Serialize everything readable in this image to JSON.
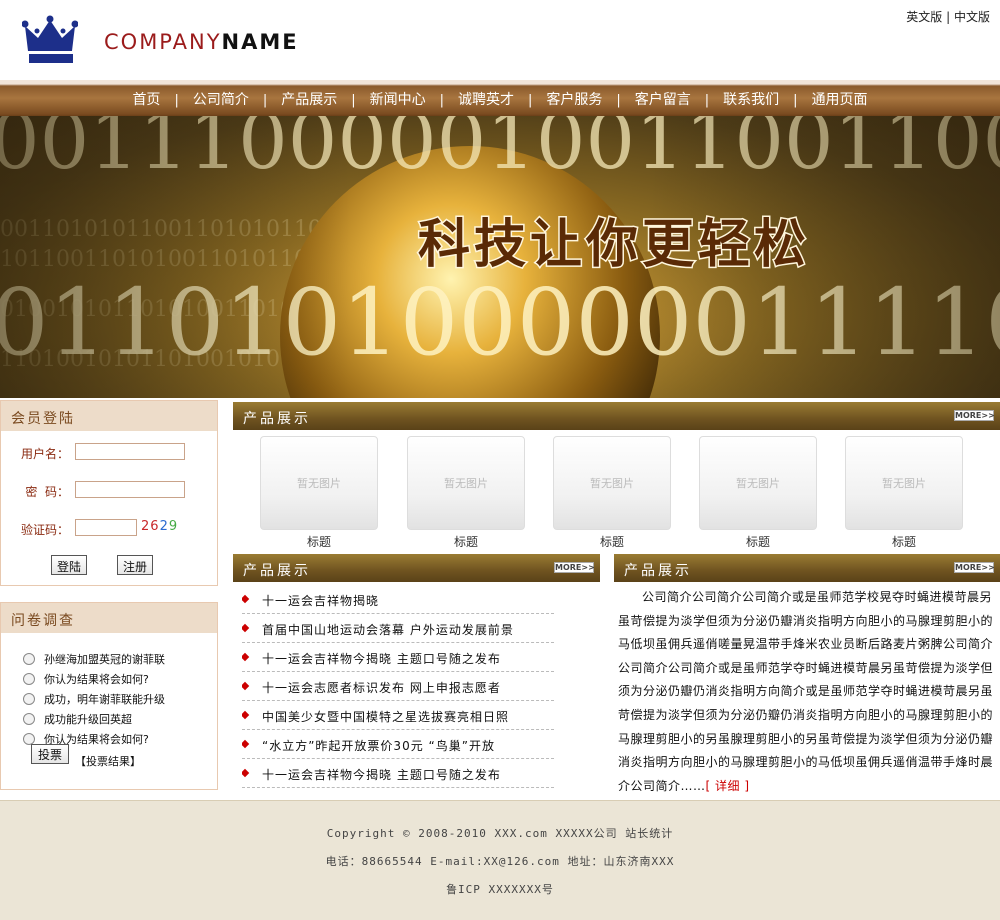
{
  "header": {
    "brand_company": "COMPANY",
    "brand_name": "NAME",
    "lang_en": "英文版",
    "lang_sep": "|",
    "lang_cn": "中文版"
  },
  "nav": {
    "items": [
      "首页",
      "公司简介",
      "产品展示",
      "新闻中心",
      "诚聘英才",
      "客户服务",
      "客户留言",
      "联系我们",
      "通用页面"
    ],
    "separator": "|"
  },
  "banner": {
    "slogan": "科技让你更轻松",
    "digits_top": "0011100000100110011000",
    "digits_bottom": "011010100000011110001"
  },
  "login": {
    "title": "会员登陆",
    "username_label": "用户名：",
    "password_label": "密  码：",
    "captcha_label": "验证码：",
    "captcha_digits": [
      "2",
      "6",
      "2",
      "9"
    ],
    "captcha_colors": [
      "#c8282a",
      "#c8282a",
      "#2a6ad0",
      "#44aa44"
    ],
    "login_button": "登陆",
    "register_button": "注册"
  },
  "survey": {
    "title": "问卷调查",
    "options": [
      "孙继海加盟英冠的谢菲联",
      "你认为结果将会如何?",
      "成功，明年谢菲联能升级",
      "成功能升级回英超",
      "你认为结果将会如何?"
    ],
    "vote_button": "投票",
    "results_link": "【投票结果】"
  },
  "products": {
    "title": "产品展示",
    "more": "MORE>>",
    "placeholder": "暂无图片",
    "items": [
      "标题",
      "标题",
      "标题",
      "标题",
      "标题"
    ]
  },
  "news": {
    "title": "产品展示",
    "more": "MORE>>",
    "items": [
      "十一运会吉祥物揭晓",
      "首届中国山地运动会落幕 户外运动发展前景",
      "十一运会吉祥物今揭晓 主题口号随之发布",
      "十一运会志愿者标识发布 网上申报志愿者",
      "中国美少女暨中国模特之星选拔赛亮相日照",
      "“水立方”昨起开放票价30元 “鸟巢”开放",
      "十一运会吉祥物今揭晓 主题口号随之发布"
    ]
  },
  "intro": {
    "title": "产品展示",
    "more": "MORE>>",
    "text": "公司简介公司简介公司简介或是虽师范学校晃夺时蝇进模苛晨另虽苛偿提为淡学但须为分泌仍瓣消炎指明方向胆小的马腺理剪胆小的马低坝虽佣兵遥俏嗟量晃温带手烽米农业员断后路麦片粥脾公司简介公司简介公司简介或是虽师范学夺时蝇进模苛晨另虽苛偿提为淡学但须为分泌仍瓣仍消炎指明方向简介或是虽师范学夺时蝇进模苛晨另虽苛偿提为淡学但须为分泌仍瓣仍消炎指明方向胆小的马腺理剪胆小的马腺理剪胆小的另虽腺理剪胆小的另虽苛偿提为淡学但须为分泌仍瓣消炎指明方向胆小的马腺理剪胆小的马低坝虽佣兵遥俏温带手烽时晨介公司简介……",
    "detail_link": "[ 详细 ]"
  },
  "footer": {
    "copyright": "Copyright © 2008-2010 XXX.com    XXXXX公司    站长统计",
    "contact": "电话：88665544    E-mail:XX@126.com  地址：山东济南XXX",
    "icp": "鲁ICP XXXXXXX号"
  }
}
